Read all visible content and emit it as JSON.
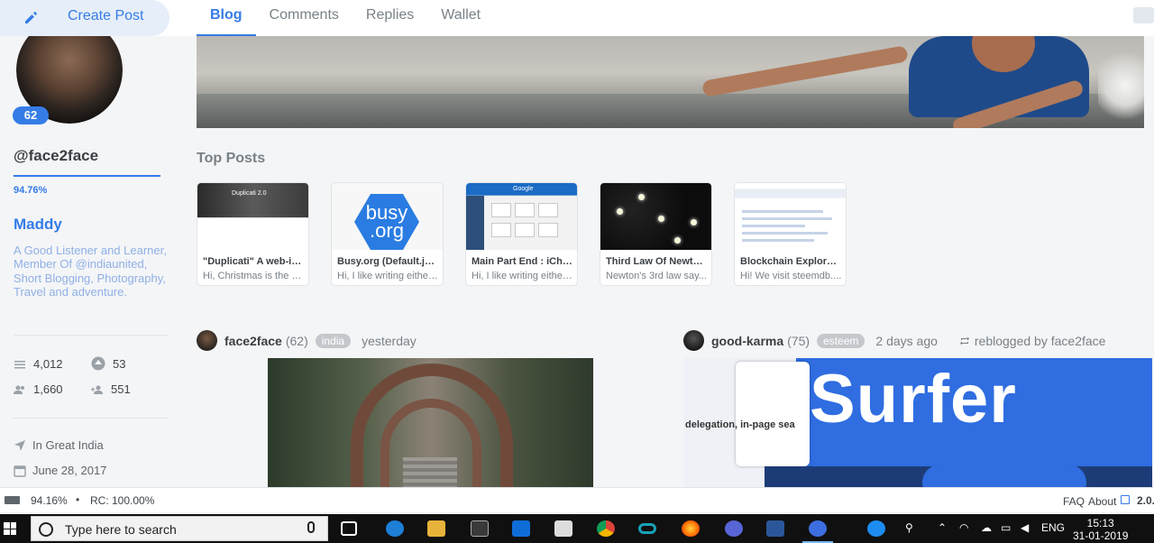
{
  "nav": {
    "create_post": "Create Post",
    "tabs": [
      "Blog",
      "Comments",
      "Replies",
      "Wallet"
    ]
  },
  "profile": {
    "reputation": "62",
    "handle": "@face2face",
    "voting_power": "94.76%",
    "voting_power_fraction": 0.9476,
    "name": "Maddy",
    "about": "A Good Listener and Learner, Member Of @indiaunited, Short Blogging, Photography, Travel and adventure.",
    "stats": {
      "posts": "4,012",
      "votes": "53",
      "followers": "1,660",
      "following": "551"
    },
    "location": "In Great India",
    "joined": "June 28, 2017"
  },
  "top_posts": {
    "title": "Top Posts",
    "cards": [
      {
        "title": "\"Duplicati\" A web-inte...",
        "snippet": "Hi, Christmas is the pr...",
        "thumb_text": "Duplicati 2.0"
      },
      {
        "title": "Busy.org (Default.jso...",
        "snippet": "Hi, I like writing either ...",
        "thumb_line1": "busy",
        "thumb_line2": ".org"
      },
      {
        "title": "Main Part End : iChro...",
        "snippet": "Hi, I like writing either ...",
        "thumb_text": "Google"
      },
      {
        "title": "Third Law Of Newton ...",
        "snippet": "Newton's 3rd law say..."
      },
      {
        "title": "Blockchain Explorer (...",
        "snippet": "Hi! We visit steemdb...."
      }
    ]
  },
  "feed": [
    {
      "author": "face2face",
      "rep": "(62)",
      "tag": "india",
      "time": "yesterday"
    },
    {
      "author": "good-karma",
      "rep": "(75)",
      "tag": "esteem",
      "time": "2 days ago",
      "reblog": "reblogged by face2face",
      "image_text": "Surfer",
      "image_caption": "delegation, in-page sea"
    }
  ],
  "footer": {
    "voting_power": "94.16%",
    "separator": "•",
    "rc": "RC: 100.00%",
    "faq": "FAQ",
    "about": "About",
    "version": "2.0."
  },
  "taskbar": {
    "search_placeholder": "Type here to search",
    "language": "ENG",
    "time": "15:13",
    "date": "31-01-2019"
  },
  "colors": {
    "accent": "#357ce6",
    "muted": "#788187",
    "tag": "#c4c8cc"
  }
}
